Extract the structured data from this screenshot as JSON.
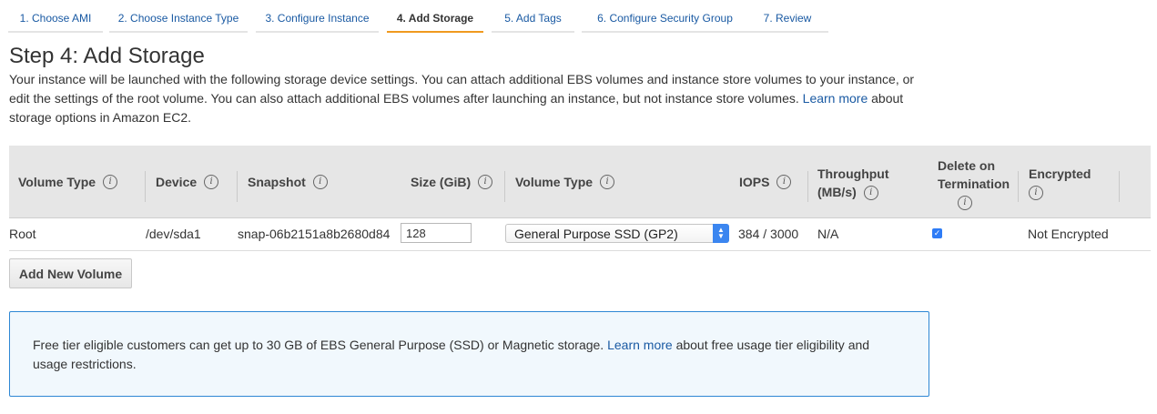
{
  "wizard": {
    "steps": [
      {
        "label": "1. Choose AMI"
      },
      {
        "label": "2. Choose Instance Type"
      },
      {
        "label": "3. Configure Instance"
      },
      {
        "label": "4. Add Storage"
      },
      {
        "label": "5. Add Tags"
      },
      {
        "label": "6. Configure Security Group"
      },
      {
        "label": "7. Review"
      }
    ],
    "active_step": "4. Add Storage"
  },
  "page": {
    "title": "Step 4: Add Storage",
    "intro_text": "Your instance will be launched with the following storage device settings. You can attach additional EBS volumes and instance store volumes to your instance, or edit the settings of the root volume. You can also attach additional EBS volumes after launching an instance, but not instance store volumes.",
    "intro_link": "Learn more",
    "intro_suffix": "about storage options in Amazon EC2."
  },
  "table": {
    "columns": [
      {
        "label": "Volume Type"
      },
      {
        "label": "Device"
      },
      {
        "label": "Snapshot"
      },
      {
        "label": "Size (GiB)"
      },
      {
        "label": "Volume Type"
      },
      {
        "label": "IOPS"
      },
      {
        "label_line1": "Throughput",
        "label_line2": "(MB/s)"
      },
      {
        "label_line1": "Delete on",
        "label_line2": "Termination"
      },
      {
        "label": "Encrypted"
      }
    ],
    "rows": [
      {
        "volume_type": "Root",
        "device": "/dev/sda1",
        "snapshot": "snap-06b2151a8b2680d84",
        "size": "128",
        "ebs_volume_type": "General Purpose SSD (GP2)",
        "iops": "384 / 3000",
        "throughput": "N/A",
        "delete_on_termination": true,
        "encrypted": "Not Encrypted"
      }
    ]
  },
  "buttons": {
    "add_new_volume": "Add New Volume"
  },
  "notice": {
    "text": "Free tier eligible customers can get up to 30 GB of EBS General Purpose (SSD) or Magnetic storage.",
    "link": "Learn more",
    "suffix": "about free usage tier eligibility and usage restrictions."
  },
  "colors": {
    "link": "#1a5aa3",
    "active_step_underline": "#f09a1f",
    "notice_border": "#2e87d4",
    "notice_bg": "#f1f8fd",
    "select_accent": "#3b86f0"
  },
  "icons": {
    "info": "info-circle-icon",
    "select_arrows": "up-down-chevron-icon",
    "checkbox": "checkmark-icon"
  }
}
